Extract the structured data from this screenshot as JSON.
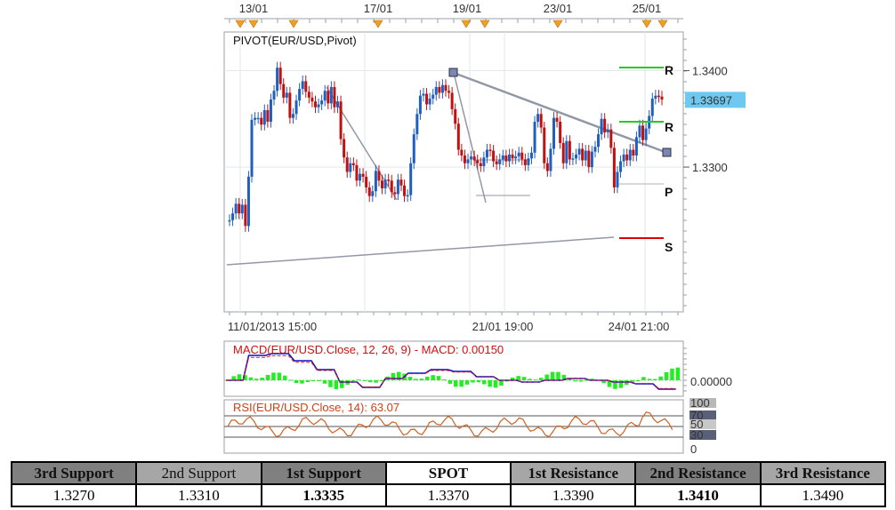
{
  "chart_data": [
    {
      "type": "candlestick",
      "title": "PIVOT(EUR/USD,Pivot)",
      "top_date_labels": [
        "13/01",
        "17/01",
        "19/01",
        "23/01",
        "25/01"
      ],
      "bottom_date_labels": [
        "11/01/2013 15:00",
        "21/01 19:00",
        "24/01 21:00"
      ],
      "y_tick_labels": [
        "1.3400",
        "1.3300"
      ],
      "ylim": [
        1.315,
        1.344
      ],
      "current_price": "1.33697",
      "pivot_markers": [
        "R",
        "R",
        "P",
        "S"
      ],
      "up_color": "#1f5fbf",
      "down_color": "#c01010",
      "close_series": [
        1.3245,
        1.3252,
        1.3262,
        1.3252,
        1.3261,
        1.3239,
        1.329,
        1.3349,
        1.3351,
        1.3351,
        1.3344,
        1.3359,
        1.3347,
        1.337,
        1.3379,
        1.3403,
        1.3386,
        1.3372,
        1.3377,
        1.3351,
        1.3355,
        1.3369,
        1.3381,
        1.3389,
        1.3378,
        1.3372,
        1.3368,
        1.3362,
        1.3365,
        1.3369,
        1.3379,
        1.3366,
        1.3383,
        1.3362,
        1.3368,
        1.3329,
        1.331,
        1.3295,
        1.3304,
        1.3302,
        1.3286,
        1.3293,
        1.329,
        1.3279,
        1.327,
        1.3275,
        1.3296,
        1.3286,
        1.3278,
        1.3287,
        1.3286,
        1.3274,
        1.3272,
        1.3287,
        1.3281,
        1.327,
        1.3271,
        1.3304,
        1.3334,
        1.3355,
        1.3374,
        1.3376,
        1.3365,
        1.3371,
        1.3375,
        1.3383,
        1.3377,
        1.3385,
        1.3379,
        1.3377,
        1.336,
        1.3345,
        1.3318,
        1.3312,
        1.3304,
        1.3308,
        1.3311,
        1.3307,
        1.3304,
        1.3301,
        1.331,
        1.3318,
        1.3317,
        1.3306,
        1.3303,
        1.3308,
        1.3312,
        1.3306,
        1.3313,
        1.3309,
        1.3311,
        1.3315,
        1.3308,
        1.3302,
        1.3309,
        1.3315,
        1.3347,
        1.3355,
        1.3341,
        1.3304,
        1.3296,
        1.3319,
        1.3351,
        1.3347,
        1.3325,
        1.3304,
        1.3327,
        1.3308,
        1.3309,
        1.3313,
        1.3319,
        1.3307,
        1.3317,
        1.33,
        1.3316,
        1.3321,
        1.3334,
        1.335,
        1.3336,
        1.3339,
        1.332,
        1.3279,
        1.3295,
        1.3306,
        1.3313,
        1.3307,
        1.3318,
        1.3312,
        1.3331,
        1.3343,
        1.3328,
        1.334,
        1.3353,
        1.3371,
        1.3374,
        1.3373,
        1.337
      ]
    },
    {
      "type": "line",
      "title": "MACD(EUR/USD.Close, 12, 26, 9) -  MACD: 0.00150",
      "y_tick_labels": [
        "0.00000"
      ]
    },
    {
      "type": "line",
      "title": "RSI(EUR/USD.Close, 14): 63.07",
      "y_tick_labels": [
        "100",
        "70",
        "50",
        "30",
        "0"
      ],
      "ylim": [
        0,
        100
      ]
    },
    {
      "type": "table",
      "columns": [
        "3rd Support",
        "2nd Support",
        "1st Support",
        "SPOT",
        "1st Resistance",
        "2nd Resistance",
        "3rd Resistance"
      ],
      "values": [
        "1.3270",
        "1.3310",
        "1.3335",
        "1.3370",
        "1.3390",
        "1.3410",
        "1.3490"
      ]
    }
  ]
}
